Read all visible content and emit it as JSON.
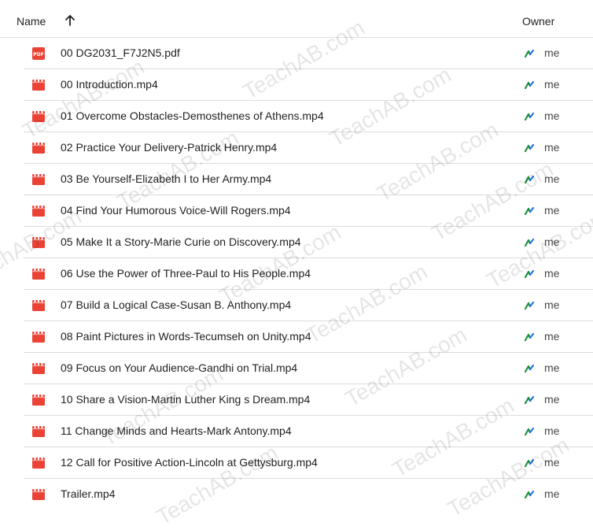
{
  "header": {
    "name_label": "Name",
    "sort_icon": "arrow-up-icon",
    "owner_label": "Owner"
  },
  "files": [
    {
      "name": "00 DG2031_F7J2N5.pdf",
      "type": "pdf",
      "owner": "me"
    },
    {
      "name": "00 Introduction.mp4",
      "type": "video",
      "owner": "me"
    },
    {
      "name": "01 Overcome Obstacles-Demosthenes of Athens.mp4",
      "type": "video",
      "owner": "me"
    },
    {
      "name": "02 Practice Your Delivery-Patrick Henry.mp4",
      "type": "video",
      "owner": "me"
    },
    {
      "name": "03 Be Yourself-Elizabeth I to Her Army.mp4",
      "type": "video",
      "owner": "me"
    },
    {
      "name": "04 Find Your Humorous Voice-Will Rogers.mp4",
      "type": "video",
      "owner": "me"
    },
    {
      "name": "05 Make It a Story-Marie Curie on Discovery.mp4",
      "type": "video",
      "owner": "me"
    },
    {
      "name": "06 Use the Power of Three-Paul to His People.mp4",
      "type": "video",
      "owner": "me"
    },
    {
      "name": "07 Build a Logical Case-Susan B. Anthony.mp4",
      "type": "video",
      "owner": "me"
    },
    {
      "name": "08 Paint Pictures in Words-Tecumseh on Unity.mp4",
      "type": "video",
      "owner": "me"
    },
    {
      "name": "09 Focus on Your Audience-Gandhi on Trial.mp4",
      "type": "video",
      "owner": "me"
    },
    {
      "name": "10 Share a Vision-Martin Luther King s Dream.mp4",
      "type": "video",
      "owner": "me"
    },
    {
      "name": "11 Change Minds and Hearts-Mark Antony.mp4",
      "type": "video",
      "owner": "me"
    },
    {
      "name": "12 Call for Positive Action-Lincoln at Gettysburg.mp4",
      "type": "video",
      "owner": "me"
    },
    {
      "name": "Trailer.mp4",
      "type": "video",
      "owner": "me"
    }
  ],
  "icons": {
    "pdf": "pdf-file-icon",
    "video": "video-file-icon",
    "owner": "shared-drive-icon"
  },
  "colors": {
    "file_icon_red": "#ea4335",
    "owner_icon_green": "#1e8e3e",
    "owner_icon_blue": "#1a73e8",
    "divider": "#dadce0"
  },
  "watermark": "TeachAB.com"
}
